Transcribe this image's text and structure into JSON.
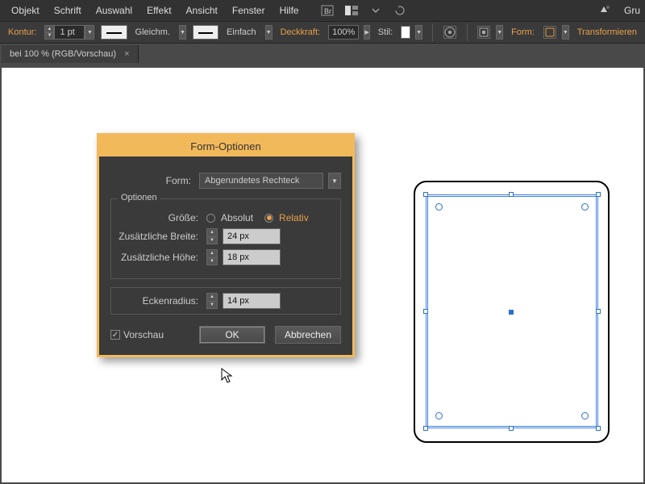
{
  "menubar": {
    "items": [
      "Objekt",
      "Schrift",
      "Auswahl",
      "Effekt",
      "Ansicht",
      "Fenster",
      "Hilfe"
    ],
    "right": [
      "Gru"
    ]
  },
  "optbar": {
    "kontur_label": "Kontur:",
    "stroke_pt": "1 pt",
    "stroke_style1": "Gleichm.",
    "stroke_style2": "Einfach",
    "opacity_label": "Deckkraft:",
    "opacity_value": "100%",
    "style_label": "Stil:",
    "form_label": "Form:",
    "transform_label": "Transformieren"
  },
  "tab": {
    "label": "bei 100 % (RGB/Vorschau)"
  },
  "dialog": {
    "title": "Form-Optionen",
    "form_label": "Form:",
    "form_value": "Abgerundetes Rechteck",
    "group_label": "Optionen",
    "size_label": "Größe:",
    "size_abs": "Absolut",
    "size_rel": "Relativ",
    "size_mode_selected": "Relativ",
    "extra_w_label": "Zusätzliche Breite:",
    "extra_w_value": "24 px",
    "extra_h_label": "Zusätzliche Höhe:",
    "extra_h_value": "18 px",
    "radius_label": "Eckenradius:",
    "radius_value": "14 px",
    "preview_label": "Vorschau",
    "preview_checked": true,
    "ok": "OK",
    "cancel": "Abbrechen"
  },
  "colors": {
    "accent": "#f2b95b",
    "link": "#e8a04a",
    "selection": "#3b82e0"
  }
}
